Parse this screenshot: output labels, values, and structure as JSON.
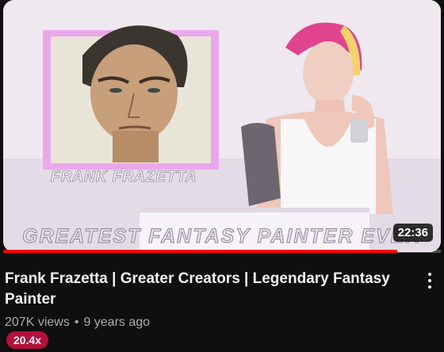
{
  "thumbnail": {
    "portrait_caption": "FRANK FRAZETTA",
    "banner_text": "GREATEST FANTASY PAINTER EVER",
    "duration": "22:36",
    "progress_fraction": 0.9
  },
  "video": {
    "title": "Frank Frazetta | Greater Creators | Legendary Fantasy Painter",
    "views": "207K views",
    "separator": "•",
    "age": "9 years ago",
    "badge": "20.4x"
  },
  "icons": {
    "menu": "more-vert-icon"
  },
  "colors": {
    "background": "#0f0f0f",
    "progress": "#ff0000",
    "badge": "#b3103a",
    "frame": "#e7a6e9",
    "hair": "#e0448f"
  }
}
